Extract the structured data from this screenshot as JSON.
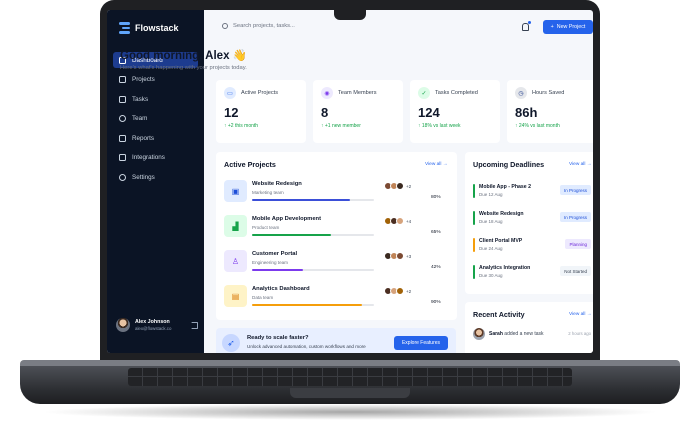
{
  "app": {
    "name": "Flowstack"
  },
  "sidebar": {
    "items": [
      {
        "label": "Dashboard",
        "icon": "grid-icon",
        "active": true
      },
      {
        "label": "Projects",
        "icon": "folder-icon"
      },
      {
        "label": "Tasks",
        "icon": "checkbox-icon"
      },
      {
        "label": "Team",
        "icon": "users-icon"
      },
      {
        "label": "Reports",
        "icon": "chart-icon"
      },
      {
        "label": "Integrations",
        "icon": "plug-icon"
      },
      {
        "label": "Settings",
        "icon": "gear-icon"
      }
    ],
    "user": {
      "name": "Alex Johnson",
      "email": "alex@flowstack.co"
    }
  },
  "topbar": {
    "search_placeholder": "Search projects, tasks...",
    "new_project_label": "New Project"
  },
  "greeting": {
    "title": "Good morning, Alex 👋",
    "subtitle": "Here's what's happening with your projects today."
  },
  "stats": [
    {
      "label": "Active Projects",
      "value": "12",
      "change": "↑ +2 this month",
      "icon": "folder-icon",
      "color": "#2563eb",
      "bg": "#e0ebff"
    },
    {
      "label": "Team Members",
      "value": "8",
      "change": "↑ +1 new member",
      "icon": "users-icon",
      "color": "#7c3aed",
      "bg": "#ede9fe"
    },
    {
      "label": "Tasks Completed",
      "value": "124",
      "change": "↑ 18% vs last week",
      "icon": "check-icon",
      "color": "#16a34a",
      "bg": "#dcfce7"
    },
    {
      "label": "Hours Saved",
      "value": "86h",
      "change": "↑ 24% vs last month",
      "icon": "clock-icon",
      "color": "#1e3a8a",
      "bg": "#e5e7eb"
    }
  ],
  "projects": {
    "title": "Active Projects",
    "view_all": "View all →",
    "items": [
      {
        "name": "Website Redesign",
        "team": "Marketing team",
        "progress": 0.8,
        "progress_label": "80%",
        "extra": "+2",
        "color": "#3b4fd8",
        "icon_bg": "#e0ebff",
        "icon": "browser-icon"
      },
      {
        "name": "Mobile App Development",
        "team": "Product team",
        "progress": 0.65,
        "progress_label": "65%",
        "extra": "+4",
        "color": "#16a34a",
        "icon_bg": "#dcfce7",
        "icon": "chart-up-icon"
      },
      {
        "name": "Customer Portal",
        "team": "Engineering team",
        "progress": 0.42,
        "progress_label": "42%",
        "extra": "+3",
        "color": "#7c3aed",
        "icon_bg": "#ede9fe",
        "icon": "user-icon"
      },
      {
        "name": "Analytics Dashboard",
        "team": "Data team",
        "progress": 0.9,
        "progress_label": "90%",
        "extra": "+2",
        "color": "#f59e0b",
        "icon_bg": "#fef3c7",
        "icon": "layout-icon"
      }
    ]
  },
  "deadlines": {
    "title": "Upcoming Deadlines",
    "view_all": "View all →",
    "items": [
      {
        "name": "Mobile App - Phase 2",
        "date": "Due 12 Aug",
        "status": "In Progress",
        "bar": "#16a34a",
        "badge_bg": "#e0ebff",
        "badge_fg": "#1d4ed8"
      },
      {
        "name": "Website Redesign",
        "date": "Due 18 Aug",
        "status": "In Progress",
        "bar": "#16a34a",
        "badge_bg": "#e0ebff",
        "badge_fg": "#1d4ed8"
      },
      {
        "name": "Client Portal MVP",
        "date": "Due 24 Aug",
        "status": "Planning",
        "bar": "#f59e0b",
        "badge_bg": "#ede9fe",
        "badge_fg": "#6d28d9"
      },
      {
        "name": "Analytics Integration",
        "date": "Due 30 Aug",
        "status": "Not Started",
        "bar": "#16a34a",
        "badge_bg": "#f1f5f9",
        "badge_fg": "#374151"
      }
    ]
  },
  "banner": {
    "title": "Ready to scale faster?",
    "subtitle": "Unlock advanced automation, custom workflows and more",
    "button": "Explore Features"
  },
  "activity": {
    "title": "Recent Activity",
    "view_all": "View all →",
    "name": "Sarah",
    "action": "added a new task",
    "time": "2 hours ago"
  }
}
